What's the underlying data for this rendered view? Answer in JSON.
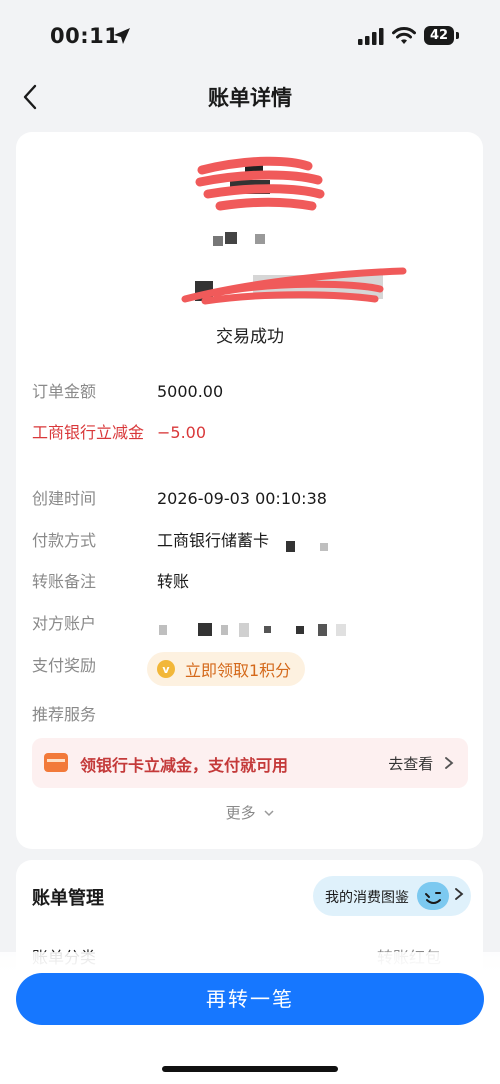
{
  "status": {
    "time": "00:11",
    "battery": "42"
  },
  "nav": {
    "title": "账单详情"
  },
  "transaction": {
    "status_text": "交易成功"
  },
  "details": [
    {
      "label": "订单金额",
      "value": "5000.00"
    },
    {
      "label": "工商银行立减金",
      "value": "−5.00"
    },
    {
      "label": "创建时间",
      "value": "2026-09-03 00:10:38"
    },
    {
      "label": "付款方式",
      "value": "工商银行储蓄卡"
    },
    {
      "label": "转账备注",
      "value": "转账"
    },
    {
      "label": "对方账户",
      "value": ""
    },
    {
      "label": "支付奖励",
      "value": ""
    },
    {
      "label": "推荐服务",
      "value": ""
    }
  ],
  "reward": {
    "label": "立即领取1积分"
  },
  "promo": {
    "text": "领银行卡立减金，支付就可用",
    "link": "去查看"
  },
  "more": {
    "label": "更多"
  },
  "management": {
    "title": "账单管理",
    "consume_label": "我的消费图鉴",
    "category_label": "账单分类",
    "category_value": "转账红包"
  },
  "cta": {
    "label": "再转一笔"
  },
  "colors": {
    "primary": "#1677ff",
    "discount": "#d9383a",
    "reward": "#d4691b"
  }
}
